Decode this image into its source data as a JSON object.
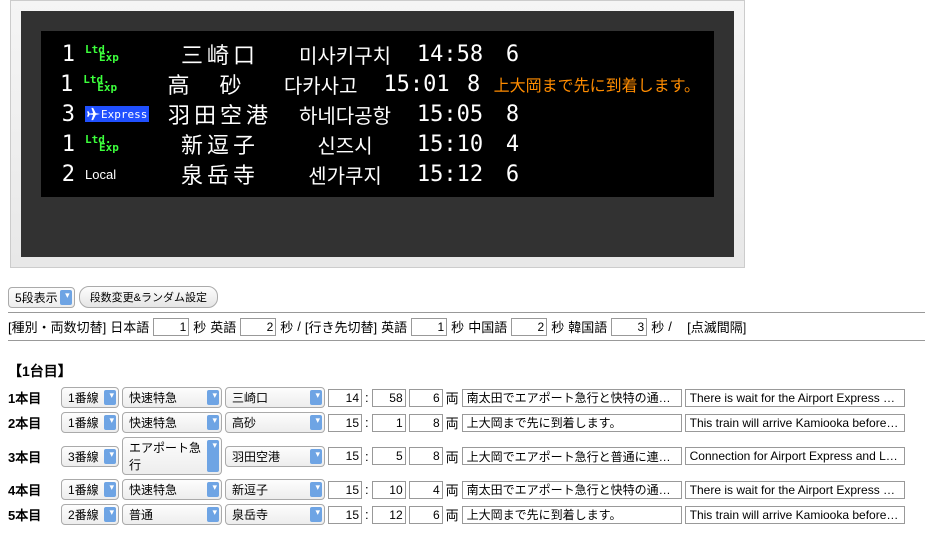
{
  "board": {
    "rows": [
      {
        "track": "1",
        "type": "ltd",
        "type_label": "Ltd.",
        "type_sub": "Exp",
        "dest_jp": "三崎口",
        "dest_kr": "미사키구치",
        "time": "14:58",
        "cars": "6",
        "msg": ""
      },
      {
        "track": "1",
        "type": "ltd",
        "type_label": "Ltd.",
        "type_sub": "Exp",
        "dest_jp": "高　砂",
        "dest_kr": "다카사고",
        "time": "15:01",
        "cars": "8",
        "msg": "上大岡まで先に到着します。"
      },
      {
        "track": "3",
        "type": "exp",
        "type_label": "Express",
        "dest_jp": "羽田空港",
        "dest_kr": "하네다공항",
        "time": "15:05",
        "cars": "8",
        "msg": ""
      },
      {
        "track": "1",
        "type": "ltd",
        "type_label": "Ltd.",
        "type_sub": "Exp",
        "dest_jp": "新逗子",
        "dest_kr": "신즈시",
        "time": "15:10",
        "cars": "4",
        "msg": ""
      },
      {
        "track": "2",
        "type": "local",
        "type_label": "Local",
        "dest_jp": "泉岳寺",
        "dest_kr": "센가쿠지",
        "time": "15:12",
        "cars": "6",
        "msg": ""
      }
    ]
  },
  "controls": {
    "row_count_select": "5段表示",
    "random_btn": "段数変更&ランダム設定",
    "type_switch_label": "[種別・両数切替]",
    "lang_jp": "日本語",
    "lang_jp_sec": "1",
    "sec": "秒",
    "lang_en": "英語",
    "lang_en_sec": "2",
    "dest_switch_label": "[行き先切替]",
    "dest_en": "英語",
    "dest_en_sec": "1",
    "dest_cn": "中国語",
    "dest_cn_sec": "2",
    "dest_kr": "韓国語",
    "dest_kr_sec": "3",
    "blink_label": "[点滅間隔]",
    "slash": "/"
  },
  "section": {
    "title": "【1台目】",
    "row_label_prefix": "本目",
    "cars_suffix": "両",
    "rows": [
      {
        "n": "1",
        "track": "1番線",
        "type": "快速特急",
        "dest": "三崎口",
        "hh": "14",
        "mm": "58",
        "cars": "6",
        "msg_jp": "南太田でエアポート急行と快特の通過待ちを",
        "msg_en": "There is wait for the Airport Express and"
      },
      {
        "n": "2",
        "track": "1番線",
        "type": "快速特急",
        "dest": "高砂",
        "hh": "15",
        "mm": "1",
        "cars": "8",
        "msg_jp": "上大岡まで先に到着します。",
        "msg_en": "This train will arrive Kamiooka before the"
      },
      {
        "n": "3",
        "track": "3番線",
        "type": "エアポート急行",
        "dest": "羽田空港",
        "hh": "15",
        "mm": "5",
        "cars": "8",
        "msg_jp": "上大岡でエアポート急行と普通に連絡します",
        "msg_en": "Connection for Airport Express and Loca"
      },
      {
        "n": "4",
        "track": "1番線",
        "type": "快速特急",
        "dest": "新逗子",
        "hh": "15",
        "mm": "10",
        "cars": "4",
        "msg_jp": "南太田でエアポート急行と快特の通過待ちを",
        "msg_en": "There is wait for the Airport Express and"
      },
      {
        "n": "5",
        "track": "2番線",
        "type": "普通",
        "dest": "泉岳寺",
        "hh": "15",
        "mm": "12",
        "cars": "6",
        "msg_jp": "上大岡まで先に到着します。",
        "msg_en": "This train will arrive Kamiooka before the"
      }
    ]
  }
}
